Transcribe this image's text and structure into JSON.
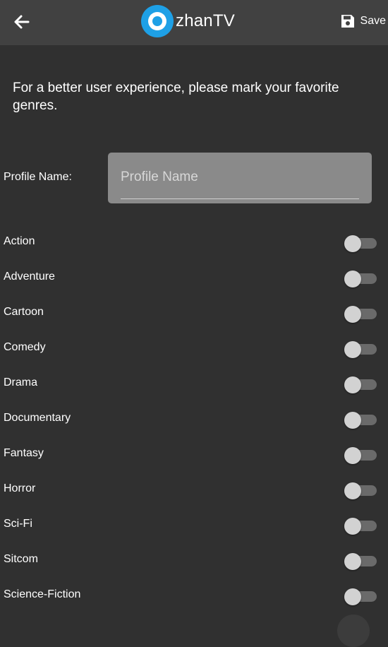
{
  "appbar": {
    "logo_text": "zhanTV",
    "save_label": "Save"
  },
  "intro_text": "For a better user experience, please mark your favorite genres.",
  "profile": {
    "label": "Profile Name:",
    "placeholder": "Profile Name",
    "value": ""
  },
  "genres": [
    {
      "label": "Action",
      "enabled": false
    },
    {
      "label": "Adventure",
      "enabled": false
    },
    {
      "label": "Cartoon",
      "enabled": false
    },
    {
      "label": "Comedy",
      "enabled": false
    },
    {
      "label": "Drama",
      "enabled": false
    },
    {
      "label": "Documentary",
      "enabled": false
    },
    {
      "label": "Fantasy",
      "enabled": false
    },
    {
      "label": "Horror",
      "enabled": false
    },
    {
      "label": "Sci-Fi",
      "enabled": false
    },
    {
      "label": "Sitcom",
      "enabled": false
    },
    {
      "label": "Science-Fiction",
      "enabled": false
    }
  ],
  "icons": {
    "back": "arrow-left-icon",
    "save": "floppy-disk-icon",
    "logo": "zhantv-logo"
  },
  "colors": {
    "background": "#303030",
    "appbar": "#414141",
    "logo_blue": "#1ea0e6",
    "field": "#8a8a8a"
  }
}
